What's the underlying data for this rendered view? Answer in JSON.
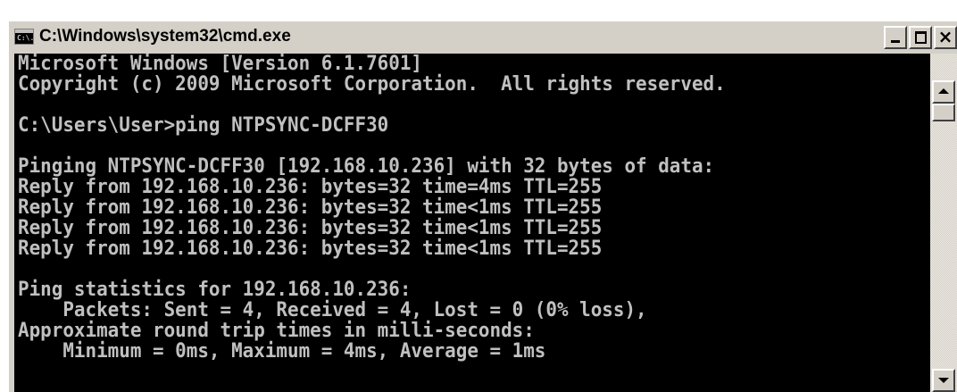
{
  "window": {
    "title": "C:\\Windows\\system32\\cmd.exe",
    "icon": "cmd-icon",
    "icon_text": "C:\\.",
    "buttons": {
      "minimize": "minimize-icon",
      "maximize": "maximize-icon",
      "close": "×"
    }
  },
  "console": {
    "colors": {
      "background": "#000000",
      "foreground": "#c0c0c0"
    },
    "lines": [
      "Microsoft Windows [Version 6.1.7601]",
      "Copyright (c) 2009 Microsoft Corporation.  All rights reserved.",
      "",
      "C:\\Users\\User>ping NTPSYNC-DCFF30",
      "",
      "Pinging NTPSYNC-DCFF30 [192.168.10.236] with 32 bytes of data:",
      "Reply from 192.168.10.236: bytes=32 time=4ms TTL=255",
      "Reply from 192.168.10.236: bytes=32 time<1ms TTL=255",
      "Reply from 192.168.10.236: bytes=32 time<1ms TTL=255",
      "Reply from 192.168.10.236: bytes=32 time<1ms TTL=255",
      "",
      "Ping statistics for 192.168.10.236:",
      "    Packets: Sent = 4, Received = 4, Lost = 0 (0% loss),",
      "Approximate round trip times in milli-seconds:",
      "    Minimum = 0ms, Maximum = 4ms, Average = 1ms",
      ""
    ]
  },
  "scrollbar": {
    "up": "scroll-up-arrow-icon",
    "down": "scroll-down-arrow-icon"
  }
}
